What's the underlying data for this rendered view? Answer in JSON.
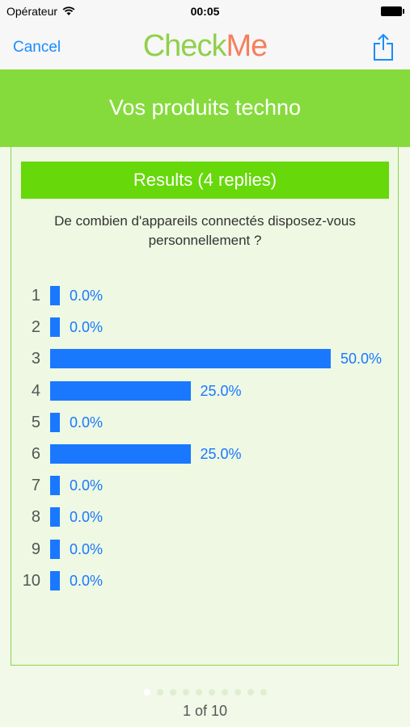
{
  "status": {
    "carrier": "Opérateur",
    "time": "00:05"
  },
  "nav": {
    "cancel": "Cancel",
    "brand_part1": "Check",
    "brand_part2": "Me"
  },
  "survey_title": "Vos produits techno",
  "results_header": "Results (4 replies)",
  "question": "De combien d'appareils connectés disposez-vous personnellement ?",
  "colors": {
    "accent": "#86db3c",
    "results_bar": "#67d80a",
    "bar": "#1a78ff",
    "link": "#1a8cff"
  },
  "chart_data": {
    "type": "bar",
    "orientation": "horizontal",
    "categories": [
      "1",
      "2",
      "3",
      "4",
      "5",
      "6",
      "7",
      "8",
      "9",
      "10"
    ],
    "values": [
      0.0,
      0.0,
      50.0,
      25.0,
      0.0,
      25.0,
      0.0,
      0.0,
      0.0,
      0.0
    ],
    "value_labels": [
      "0.0%",
      "0.0%",
      "50.0%",
      "25.0%",
      "0.0%",
      "25.0%",
      "0.0%",
      "0.0%",
      "0.0%",
      "0.0%"
    ],
    "xlim": [
      0,
      50
    ]
  },
  "pager": {
    "text": "1 of 10",
    "total_pages": 10,
    "current_page": 1
  }
}
